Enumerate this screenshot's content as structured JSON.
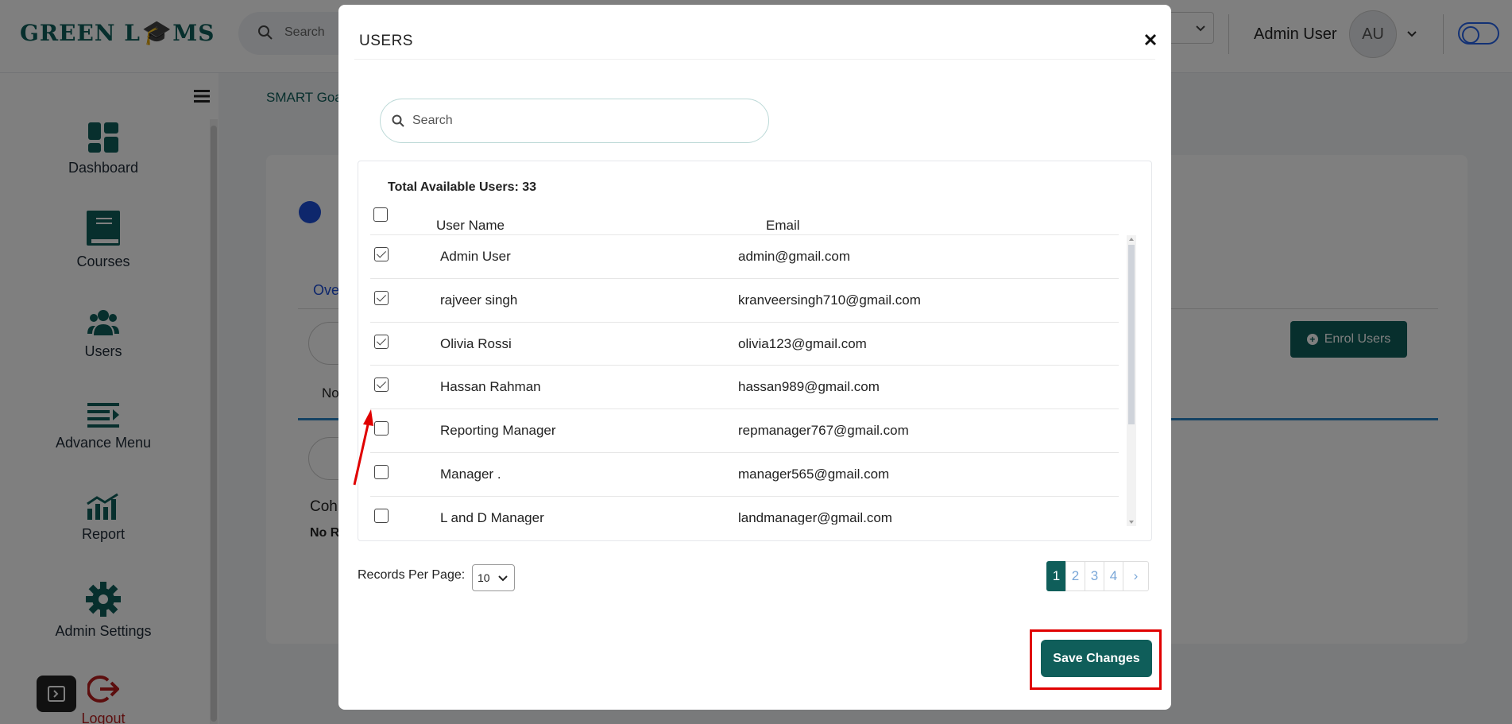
{
  "app": {
    "logo_text": "GREEN L",
    "logo_tail": "MS",
    "search_placeholder": "Search",
    "admin_name": "Admin User",
    "avatar_initials": "AU"
  },
  "sidebar": {
    "items": [
      {
        "label": "Dashboard",
        "icon": "dashboard-icon"
      },
      {
        "label": "Courses",
        "icon": "book-icon"
      },
      {
        "label": "Users",
        "icon": "users-icon"
      },
      {
        "label": "Advance Menu",
        "icon": "menu-icon"
      },
      {
        "label": "Report",
        "icon": "chart-icon"
      },
      {
        "label": "Admin Settings",
        "icon": "gear-icon"
      },
      {
        "label": "Logout",
        "icon": "logout-icon"
      }
    ]
  },
  "background": {
    "breadcrumb": "SMART Goa",
    "tab_partial": "Ove",
    "text_partial_1": "No",
    "text_partial_2": "Coh",
    "text_partial_3": "No R",
    "enrol_label": "Enrol Users"
  },
  "modal": {
    "title": "USERS",
    "search_placeholder": "Search",
    "total_label": "Total Available Users: 33",
    "columns": {
      "name": "User Name",
      "email": "Email"
    },
    "rows": [
      {
        "name": "Admin User",
        "email": "admin@gmail.com",
        "checked": true
      },
      {
        "name": "rajveer singh",
        "email": "kranveersingh710@gmail.com",
        "checked": true
      },
      {
        "name": "Olivia Rossi",
        "email": "olivia123@gmail.com",
        "checked": true
      },
      {
        "name": "Hassan Rahman",
        "email": "hassan989@gmail.com",
        "checked": true
      },
      {
        "name": "Reporting Manager",
        "email": "repmanager767@gmail.com",
        "checked": false
      },
      {
        "name": "Manager .",
        "email": "manager565@gmail.com",
        "checked": false
      },
      {
        "name": "L and D Manager",
        "email": "landmanager@gmail.com",
        "checked": false
      }
    ],
    "records_per_page_label": "Records Per Page:",
    "records_per_page_value": "10",
    "pages": [
      "1",
      "2",
      "3",
      "4"
    ],
    "active_page": "1",
    "next_symbol": "›",
    "save_label": "Save Changes"
  },
  "colors": {
    "brand": "#0f5e5a",
    "annotation": "#e00000"
  }
}
